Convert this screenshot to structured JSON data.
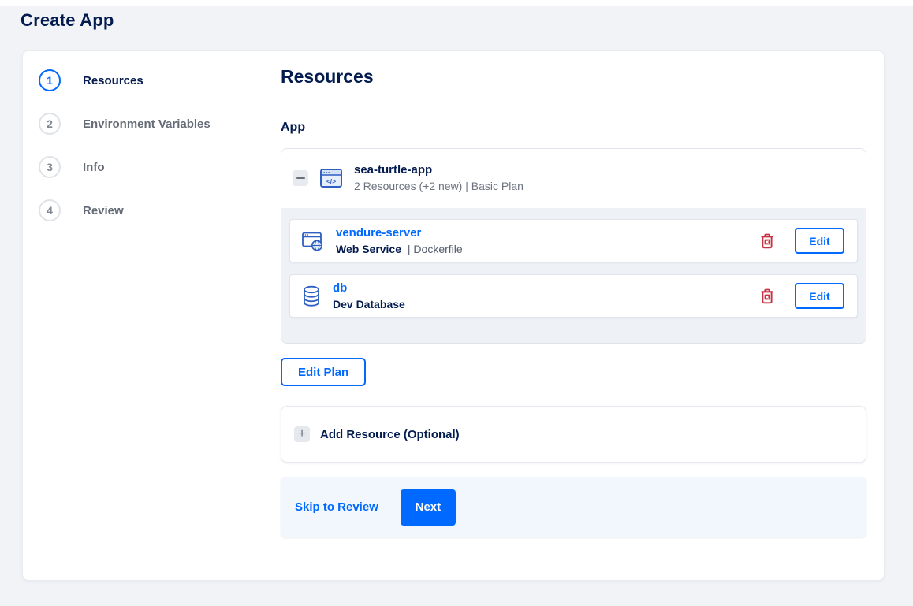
{
  "page": {
    "title": "Create App"
  },
  "steps": [
    {
      "number": "1",
      "label": "Resources",
      "active": true
    },
    {
      "number": "2",
      "label": "Environment Variables",
      "active": false
    },
    {
      "number": "3",
      "label": "Info",
      "active": false
    },
    {
      "number": "4",
      "label": "Review",
      "active": false
    }
  ],
  "content": {
    "heading": "Resources",
    "section_label": "App",
    "app_card": {
      "name": "sea-turtle-app",
      "summary": "2 Resources (+2 new) | Basic Plan",
      "resources": [
        {
          "name": "vendure-server",
          "type": "Web Service",
          "detail": "| Dockerfile",
          "icon": "web-service-icon",
          "edit_label": "Edit"
        },
        {
          "name": "db",
          "type": "Dev Database",
          "detail": "",
          "icon": "database-icon",
          "edit_label": "Edit"
        }
      ]
    },
    "edit_plan_label": "Edit Plan",
    "add_resource_label": "Add Resource (Optional)",
    "footer": {
      "skip_label": "Skip to Review",
      "next_label": "Next"
    }
  },
  "colors": {
    "accent_blue": "#0069ff",
    "dark_navy": "#031b4e",
    "danger_red": "#c63342",
    "icon_blue": "#2f5fc0",
    "page_bg": "#f1f3f7",
    "card_body_bg": "#eef1f6",
    "footer_bg": "#f2f7fd"
  }
}
